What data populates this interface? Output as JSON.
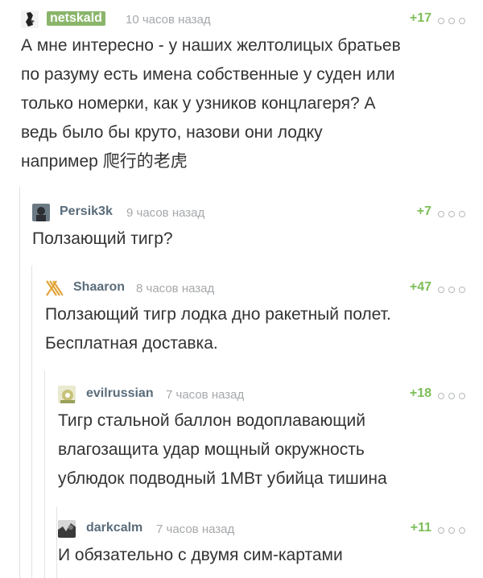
{
  "comments": [
    {
      "author": "netskald",
      "time": "10 часов назад",
      "rating": "+17",
      "avatar_icon": "user-avatar-icon",
      "text": "А мне интересно - у наших желтолицых братьев\nпо разуму есть имена собственные у суден или\nтолько номерки, как у узников концлагеря? А\nведь было бы круто, назови они лодку\nнапример 爬行的老虎"
    },
    {
      "author": "Persik3k",
      "time": "9 часов назад",
      "rating": "+7",
      "avatar_icon": "user-avatar-icon",
      "text": "Ползающий тигр?"
    },
    {
      "author": "Shaaron",
      "time": "8 часов назад",
      "rating": "+47",
      "avatar_icon": "striped-avatar-icon",
      "text": "Ползающий тигр лодка дно ракетный полет.\nБесплатная доставка."
    },
    {
      "author": "evilrussian",
      "time": "7 часов назад",
      "rating": "+18",
      "avatar_icon": "user-avatar-icon",
      "text": "Тигр стальной баллон водоплавающий\nвлагозащита удар мощный окружность\nублюдок подводный 1МВт убийца тишина"
    },
    {
      "author": "darkcalm",
      "time": "7 часов назад",
      "rating": "+11",
      "avatar_icon": "user-avatar-icon",
      "text": "И обязательно с двумя сим-картами"
    }
  ],
  "colors": {
    "author": "#5a6c7a",
    "author_highlight_bg": "#8ab56b",
    "rating": "#7dbe59",
    "time": "#a5a8ab",
    "text": "#333333",
    "branch_line": "#dfe2e5"
  }
}
